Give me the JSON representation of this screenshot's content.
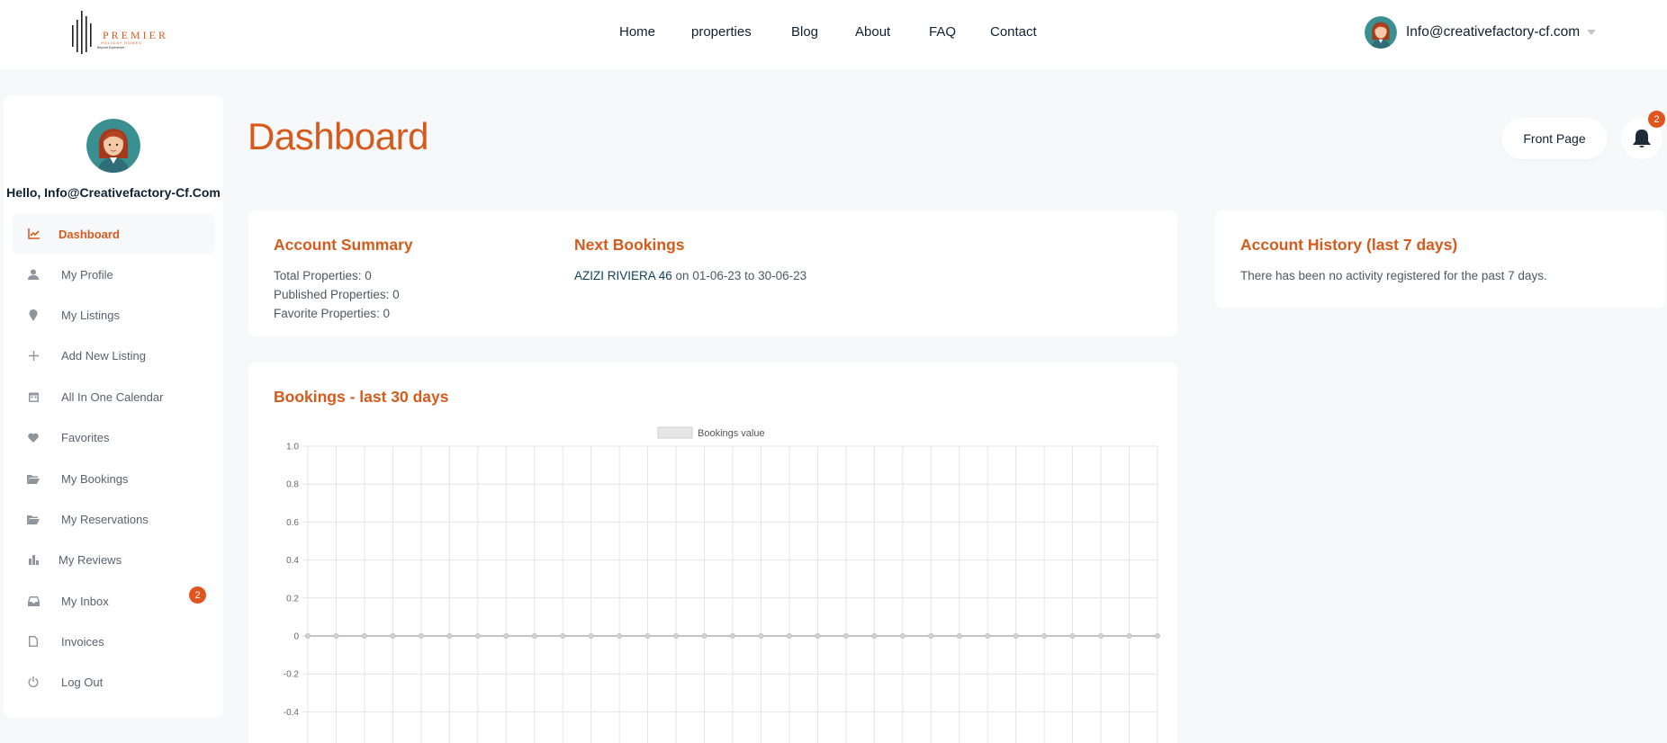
{
  "brand": {
    "name": "PREMIER",
    "subtitle": "HOLIDAY HOMES",
    "tagline": "Beyond Experience"
  },
  "nav": {
    "items": [
      "Home",
      "properties",
      "Blog",
      "About",
      "FAQ",
      "Contact"
    ]
  },
  "user": {
    "email": "Info@creativefactory-cf.com",
    "greeting": "Hello, Info@Creativefactory-Cf.Com"
  },
  "sidebar": {
    "items": [
      {
        "label": "Dashboard",
        "icon": "chart-line-icon",
        "active": true
      },
      {
        "label": "My Profile",
        "icon": "user-icon"
      },
      {
        "label": "My Listings",
        "icon": "map-pin-icon"
      },
      {
        "label": "Add New Listing",
        "icon": "plus-icon"
      },
      {
        "label": "All In One Calendar",
        "icon": "calendar-icon"
      },
      {
        "label": "Favorites",
        "icon": "heart-icon"
      },
      {
        "label": "My Bookings",
        "icon": "folder-open-icon"
      },
      {
        "label": "My Reservations",
        "icon": "folder-open-icon"
      },
      {
        "label": "My Reviews",
        "icon": "bar-chart-icon"
      },
      {
        "label": "My Inbox",
        "icon": "inbox-icon",
        "badge": "2"
      },
      {
        "label": "Invoices",
        "icon": "file-icon"
      },
      {
        "label": "Log Out",
        "icon": "power-icon"
      }
    ]
  },
  "header": {
    "title": "Dashboard",
    "front_page_label": "Front Page",
    "notification_count": "2"
  },
  "account_summary": {
    "title": "Account Summary",
    "total": "Total Properties: 0",
    "published": "Published Properties: 0",
    "favorite": "Favorite Properties: 0"
  },
  "next_bookings": {
    "title": "Next Bookings",
    "property": "AZIZI RIVIERA 46",
    "dates": " on 01-06-23 to 30-06-23"
  },
  "account_history": {
    "title": "Account History (last 7 days)",
    "message": "There has been no activity registered for the past 7 days."
  },
  "bookings_chart": {
    "title": "Bookings - last 30 days"
  },
  "colors": {
    "accent": "#d65a1c",
    "badge": "#e0541d",
    "navy": "#0f2233",
    "background": "#f7f8fa"
  },
  "chart_data": {
    "type": "line",
    "legend": "Bookings value",
    "legend_position": "top-center",
    "x_count": 31,
    "values": [
      0,
      0,
      0,
      0,
      0,
      0,
      0,
      0,
      0,
      0,
      0,
      0,
      0,
      0,
      0,
      0,
      0,
      0,
      0,
      0,
      0,
      0,
      0,
      0,
      0,
      0,
      0,
      0,
      0,
      0,
      0
    ],
    "y_ticks": [
      "1.0",
      "0.8",
      "0.6",
      "0.4",
      "0.2",
      "0",
      "-0.2",
      "-0.4"
    ],
    "ylim": [
      -1,
      1
    ],
    "grid": true
  }
}
